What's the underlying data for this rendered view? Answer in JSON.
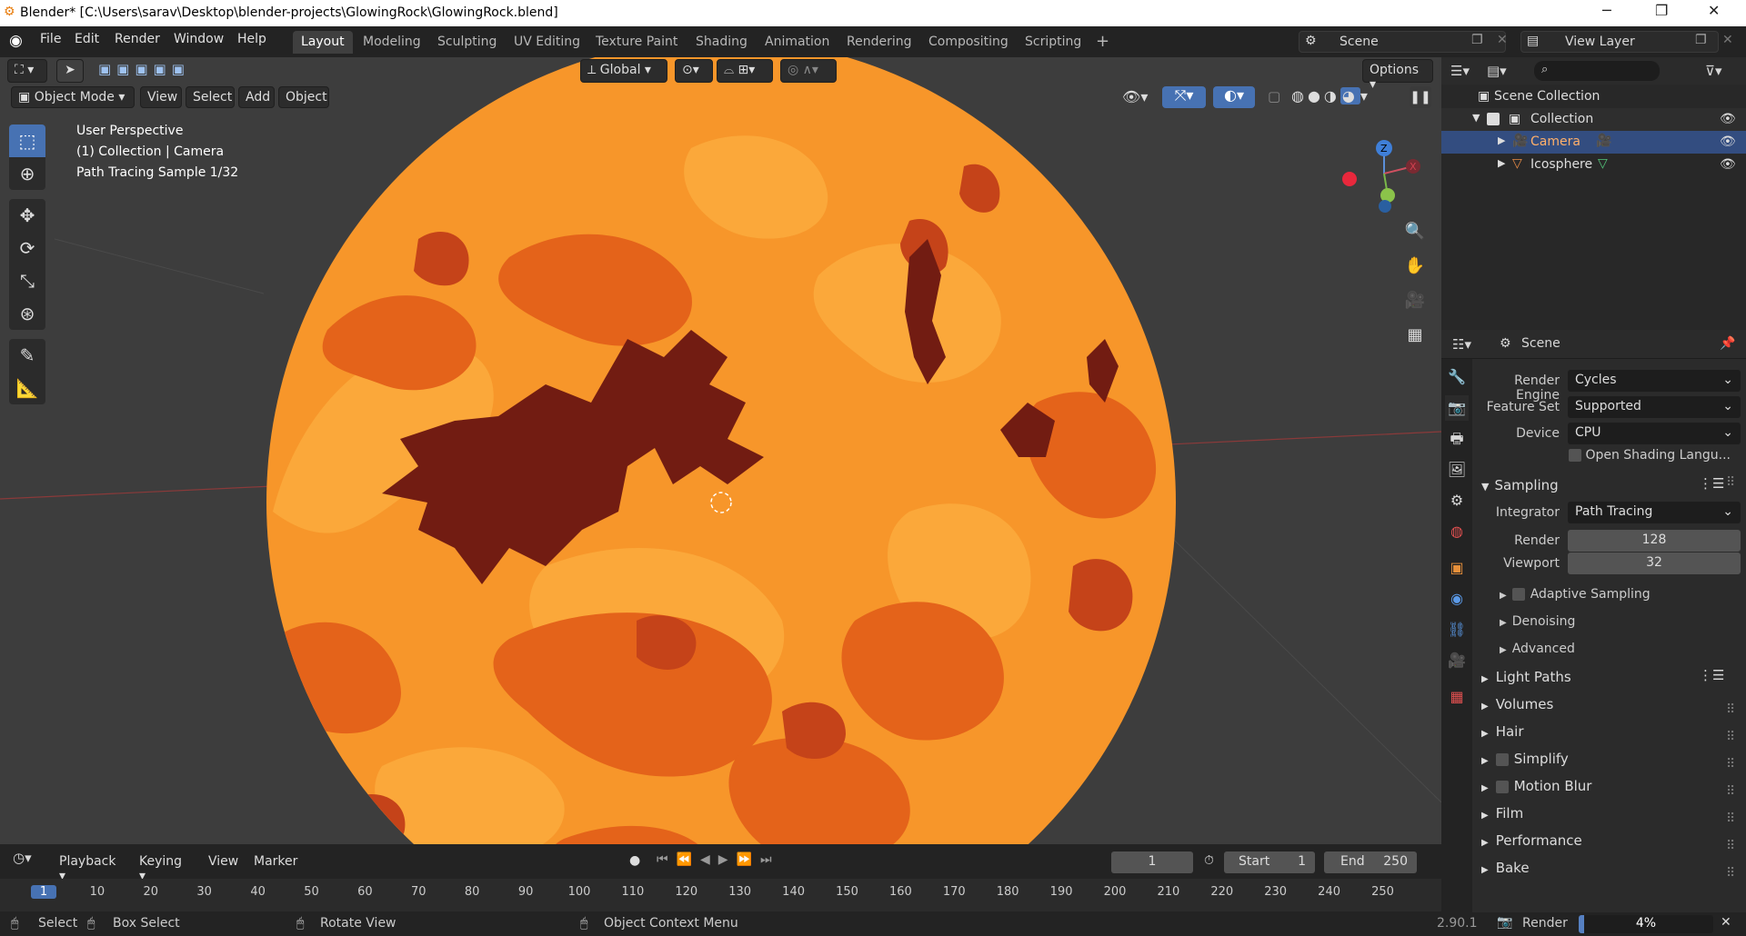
{
  "window": {
    "title": "Blender* [C:\\Users\\sarav\\Desktop\\blender-projects\\GlowingRock\\GlowingRock.blend]",
    "minimize": "─",
    "restore": "❐",
    "close": "✕"
  },
  "menu": [
    "File",
    "Edit",
    "Render",
    "Window",
    "Help"
  ],
  "workspaces": [
    "Layout",
    "Modeling",
    "Sculpting",
    "UV Editing",
    "Texture Paint",
    "Shading",
    "Animation",
    "Rendering",
    "Compositing",
    "Scripting",
    "+"
  ],
  "scene_name": "Scene",
  "view_layer": "View Layer",
  "viewport": {
    "mode": "Object Mode",
    "menus": [
      "View",
      "Select",
      "Add",
      "Object"
    ],
    "orientation": "Global",
    "options": "Options",
    "overlay_lines": [
      "User Perspective",
      "(1) Collection | Camera",
      "Path Tracing Sample 1/32"
    ],
    "gizmo": {
      "z": "Z",
      "x": "X",
      "y": "Y"
    },
    "tools": [
      "select-box",
      "cursor",
      "move",
      "rotate",
      "scale",
      "transform",
      "annotate",
      "measure"
    ],
    "colors": {
      "bg": "#3d3d3d",
      "sphere_base": "#f7962a",
      "sphere_light": "#fba83a",
      "patch_mid": "#e4631a",
      "patch_dark": "#c54319",
      "patch_darkest": "#721c12"
    }
  },
  "outliner": {
    "root": "Scene Collection",
    "items": [
      {
        "label": "Collection",
        "selected": false
      },
      {
        "label": "Camera",
        "selected": true
      },
      {
        "label": "Icosphere",
        "selected": false
      }
    ]
  },
  "properties": {
    "header": "Scene",
    "render_engine": {
      "label": "Render Engine",
      "value": "Cycles"
    },
    "feature_set": {
      "label": "Feature Set",
      "value": "Supported"
    },
    "device": {
      "label": "Device",
      "value": "CPU"
    },
    "osl": "Open Shading Langu...",
    "sampling": {
      "title": "Sampling",
      "integrator": {
        "label": "Integrator",
        "value": "Path Tracing"
      },
      "render": {
        "label": "Render",
        "value": "128"
      },
      "viewport": {
        "label": "Viewport",
        "value": "32"
      },
      "subpanels": [
        "Adaptive Sampling",
        "Denoising",
        "Advanced"
      ]
    },
    "panels": [
      "Light Paths",
      "Volumes",
      "Hair",
      "Simplify",
      "Motion Blur",
      "Film",
      "Performance",
      "Bake"
    ]
  },
  "timeline": {
    "menus": [
      "Playback",
      "Keying",
      "View",
      "Marker"
    ],
    "current_frame": "1",
    "start_label": "Start",
    "start": "1",
    "end_label": "End",
    "end": "250",
    "ticks": [
      "1",
      "10",
      "20",
      "30",
      "40",
      "50",
      "60",
      "70",
      "80",
      "90",
      "100",
      "110",
      "120",
      "130",
      "140",
      "150",
      "160",
      "170",
      "180",
      "190",
      "200",
      "210",
      "220",
      "230",
      "240",
      "250"
    ]
  },
  "status": {
    "select": "Select",
    "box_select": "Box Select",
    "rotate": "Rotate View",
    "context": "Object Context Menu",
    "version": "2.90.1",
    "render_label": "Render",
    "progress_text": "4%",
    "progress": 0.04
  }
}
